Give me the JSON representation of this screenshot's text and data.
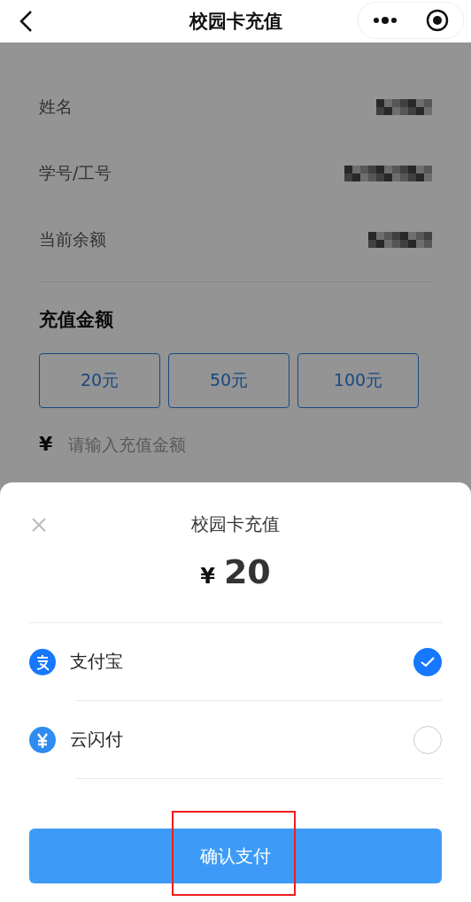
{
  "nav": {
    "title": "校园卡充值"
  },
  "info_rows": [
    {
      "label": "姓名"
    },
    {
      "label": "学号/工号"
    },
    {
      "label": "当前余额"
    }
  ],
  "recharge": {
    "title": "充值金额",
    "options": [
      {
        "label": "20元",
        "selected": false
      },
      {
        "label": "50元",
        "selected": false
      },
      {
        "label": "100元",
        "selected": false
      }
    ],
    "currency": "¥",
    "placeholder": "请输入充值金额"
  },
  "payment_sheet": {
    "title": "校园卡充值",
    "currency": "¥",
    "amount": "20",
    "methods": [
      {
        "kind": "alipay",
        "name": "支付宝",
        "selected": true
      },
      {
        "kind": "unionpay",
        "name": "云闪付",
        "selected": false
      }
    ],
    "confirm": "确认支付",
    "highlighted": true
  }
}
